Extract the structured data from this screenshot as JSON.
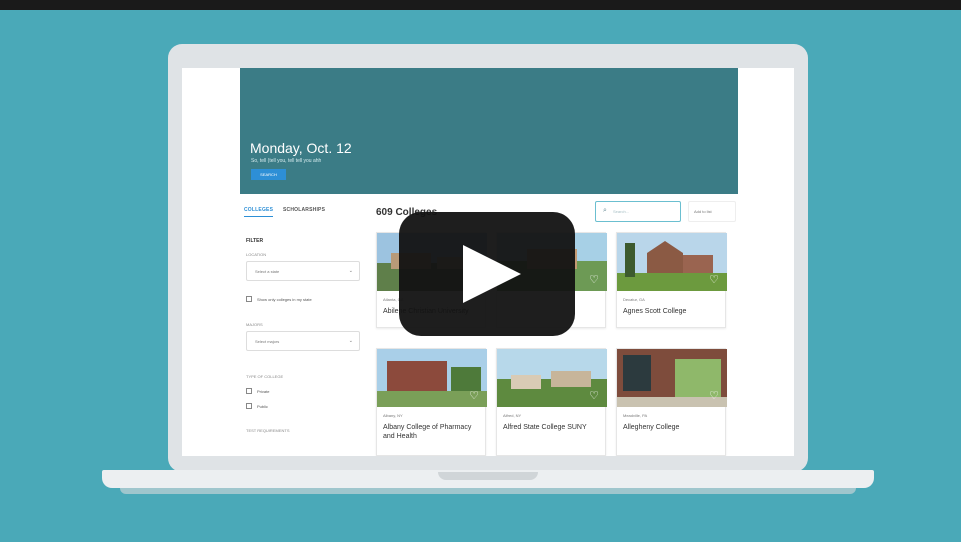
{
  "hero": {
    "date": "Monday, Oct. 12",
    "subtitle": "So, tell (tell you, tell tell you ahh",
    "button": "SEARCH"
  },
  "tabs": [
    {
      "label": "COLLEGES"
    },
    {
      "label": "SCHOLARSHIPS"
    }
  ],
  "sidebar": {
    "filter": "FILTER",
    "label_1": "LOCATION",
    "select_1": "Select a state",
    "checkbox_main": "Show only colleges in my state",
    "label_2": "MAJORS",
    "select_2": "Select majors",
    "label_3": "TYPE OF COLLEGE",
    "opt_private": "Private",
    "opt_public": "Public",
    "label_4": "TEST REQUIREMENTS"
  },
  "results": {
    "title": "609 Colleges",
    "search_placeholder": "Search...",
    "add_list": "Add to list"
  },
  "cards": [
    {
      "location": "Atlanta, GA",
      "name": "Abilene Christian University"
    },
    {
      "location": "Decatur, GA",
      "name": "Agnes Scott College"
    },
    {
      "location": "Albany, NY",
      "name": "Albany College of Pharmacy and Health"
    },
    {
      "location": "Alfred, NY",
      "name": "Alfred State College SUNY"
    },
    {
      "location": "Meadville, PA",
      "name": "Allegheny College"
    }
  ]
}
